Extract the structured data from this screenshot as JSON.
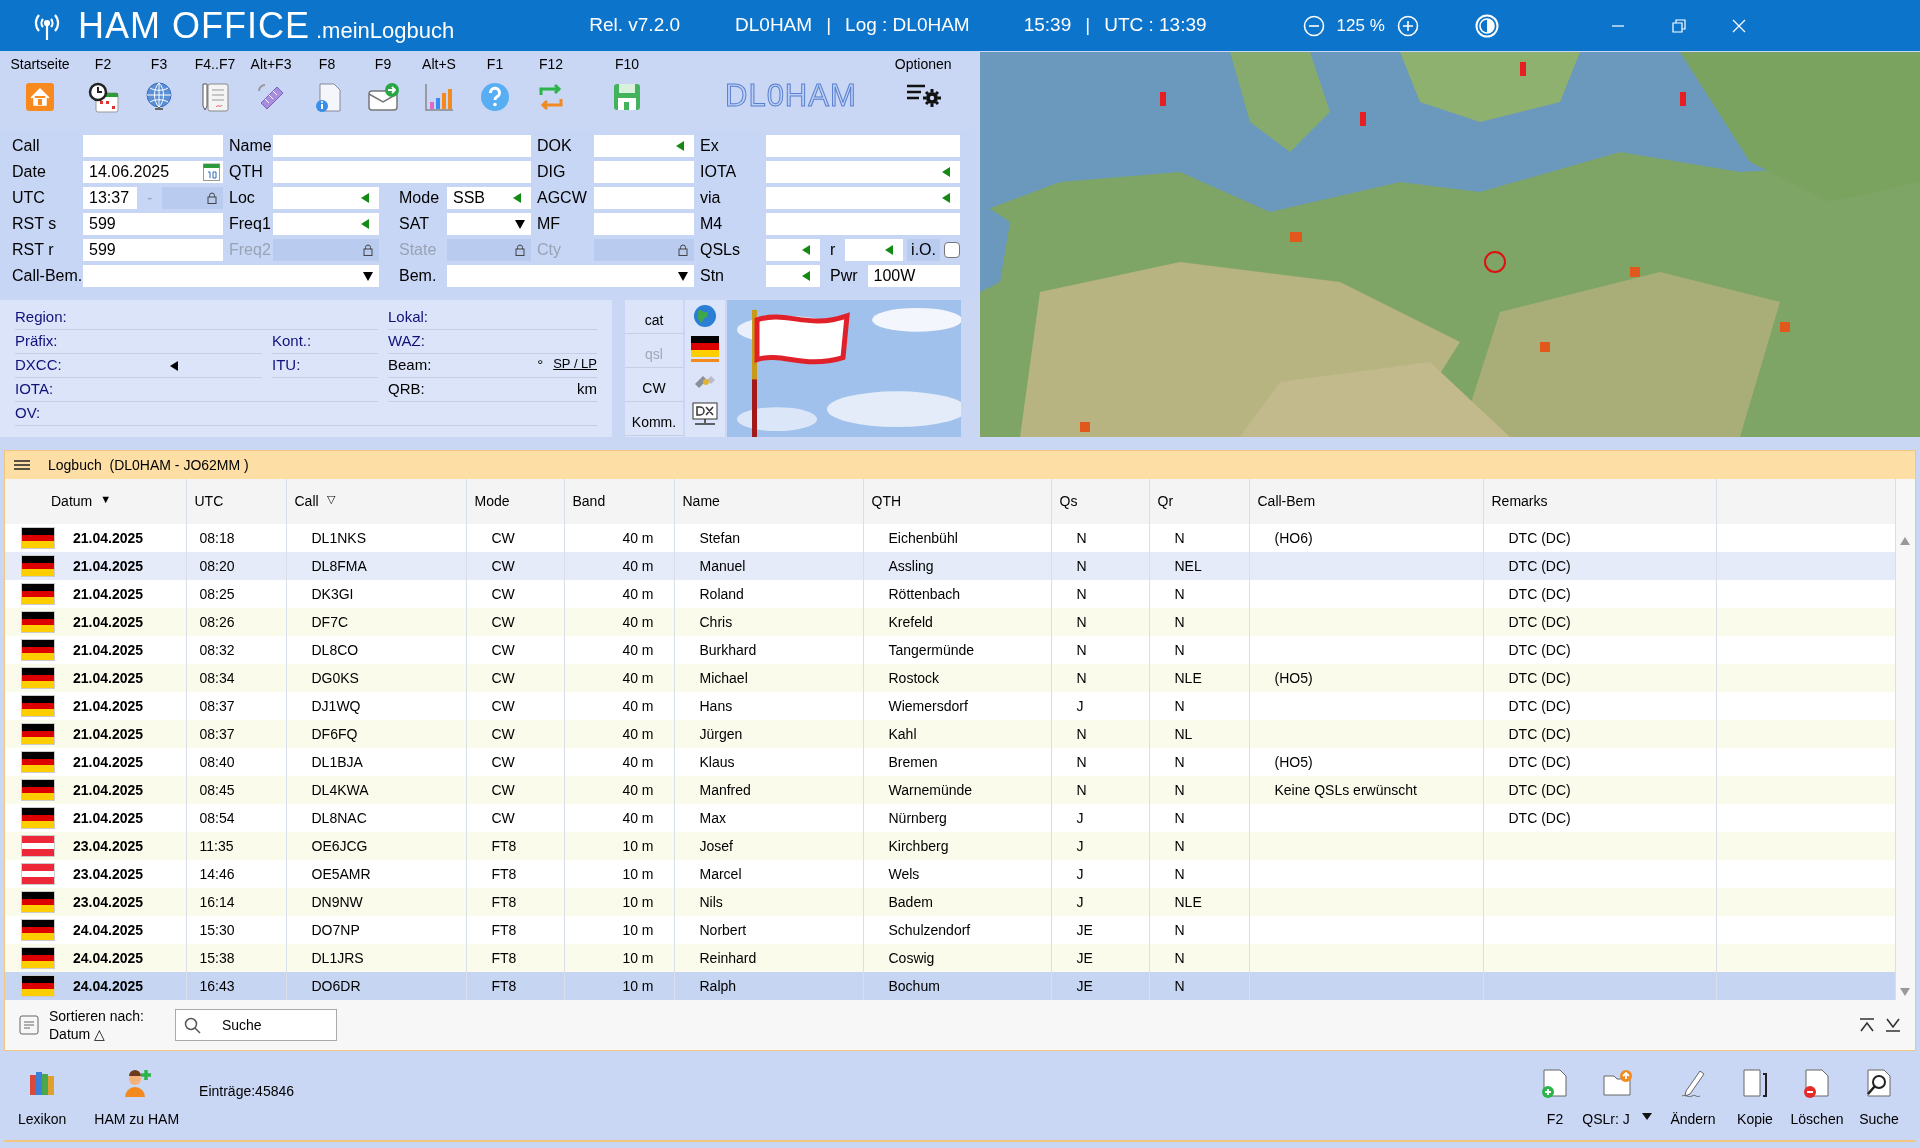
{
  "title_bar": {
    "app_name": "HAM OFFICE",
    "app_suffix": ".meinLogbuch",
    "release": "Rel. v7.2.0",
    "station": "DL0HAM",
    "separator_1": "|",
    "log": "Log : DL0HAM",
    "time": "15:39",
    "separator_2": "|",
    "utc": "UTC : 13:39",
    "zoom": "125 %"
  },
  "toolbar": {
    "items": [
      {
        "key": "Startseite"
      },
      {
        "key": "F2"
      },
      {
        "key": "F3"
      },
      {
        "key": "F4..F7"
      },
      {
        "key": "Alt+F3"
      },
      {
        "key": "F8"
      },
      {
        "key": "F9"
      },
      {
        "key": "Alt+S"
      },
      {
        "key": "F1"
      },
      {
        "key": "F12"
      },
      {
        "key": "F10"
      }
    ],
    "callsign": "DL0HAM",
    "options": "Optionen"
  },
  "form": {
    "rows": [
      {
        "fields": [
          {
            "label": "Call",
            "kind": "text"
          },
          {
            "label": "Name",
            "kind": "text"
          },
          {
            "label": "DOK",
            "kind": "text",
            "arrow": true
          },
          {
            "label": "Ex",
            "kind": "text"
          }
        ]
      },
      {
        "fields": [
          {
            "label": "Date",
            "kind": "date",
            "value": "14.06.2025"
          },
          {
            "label": "QTH",
            "kind": "text"
          },
          {
            "label": "DIG",
            "kind": "text"
          },
          {
            "label": "IOTA",
            "kind": "text",
            "arrow": true
          }
        ]
      },
      {
        "fields": [
          {
            "label": "UTC",
            "kind": "text",
            "value": "13:37",
            "extra": [
              {
                "label": "-",
                "kind": "text",
                "disabled": true,
                "locked": true
              }
            ]
          },
          {
            "label": "Loc",
            "kind": "text",
            "arrow": true
          },
          {
            "label": "Mode",
            "kind": "text",
            "value": "SSB",
            "arrow": true
          },
          {
            "label": "AGCW",
            "kind": "text"
          },
          {
            "label": "via",
            "kind": "text",
            "arrow": true
          }
        ]
      },
      {
        "fields": [
          {
            "label": "RST s",
            "kind": "text",
            "value": "599"
          },
          {
            "label": "Freq1",
            "kind": "text",
            "arrow": true
          },
          {
            "label": "SAT",
            "kind": "select"
          },
          {
            "label": "MF",
            "kind": "text"
          },
          {
            "label": "M4",
            "kind": "text"
          }
        ]
      },
      {
        "fields": [
          {
            "label": "RST r",
            "kind": "text",
            "value": "599"
          },
          {
            "label": "Freq2",
            "kind": "text",
            "disabled": true,
            "locked": true
          },
          {
            "label": "State",
            "kind": "text",
            "disabled": true,
            "locked": true
          },
          {
            "label": "Cty",
            "kind": "text",
            "disabled": true,
            "locked": true
          },
          {
            "label": "QSLs",
            "kind": "text",
            "arrow": true,
            "extra": [
              {
                "label": "r",
                "kind": "text",
                "arrow": true
              },
              {
                "label": "i.O.",
                "kind": "checkbox",
                "checked": false
              }
            ]
          }
        ]
      },
      {
        "fields": [
          {
            "label": "Call-Bem.",
            "kind": "select"
          },
          {
            "label": "Bem.",
            "kind": "select"
          },
          {
            "label": "Stn",
            "kind": "text",
            "arrow": true,
            "extra": [
              {
                "label": "Pwr",
                "kind": "text",
                "value": "100W"
              }
            ]
          }
        ]
      }
    ]
  },
  "info": {
    "region": "Region:",
    "lokal": "Lokal:",
    "praefix": "Präfix:",
    "kont": "Kont.:",
    "waz": "WAZ:",
    "dxcc": "DXCC:",
    "itu": "ITU:",
    "beam": "Beam:",
    "degree": "°",
    "sp_lp": "SP / LP",
    "iota": "IOTA:",
    "qrb": "QRB:",
    "km": "km",
    "ov": "OV:"
  },
  "side_buttons": [
    {
      "label": "cat",
      "disabled": false
    },
    {
      "label": "qsl",
      "disabled": true
    },
    {
      "label": "CW",
      "disabled": false
    },
    {
      "label": "Komm.",
      "disabled": false
    }
  ],
  "logbook": {
    "title": "Logbuch  (DL0HAM - JO62MM )",
    "columns": [
      {
        "label": "Datum",
        "sort": "▼"
      },
      {
        "label": "UTC"
      },
      {
        "label": "Call",
        "sort": "▽"
      },
      {
        "label": "Mode"
      },
      {
        "label": "Band"
      },
      {
        "label": "Name"
      },
      {
        "label": "QTH"
      },
      {
        "label": "Qs"
      },
      {
        "label": "Qr"
      },
      {
        "label": "Call-Bem"
      },
      {
        "label": "Remarks"
      }
    ],
    "rows": [
      {
        "kind": "de",
        "date": "21.04.2025",
        "utc": "08:18",
        "call": "DL1NKS",
        "mode": "CW",
        "band": "40 m",
        "name": "Stefan",
        "qth": "Eichenbühl",
        "qs": "N",
        "qr": "N",
        "call_bem": "(HO6)",
        "remarks": "DTC (DC)",
        "marked": false,
        "selected": false
      },
      {
        "kind": "de",
        "date": "21.04.2025",
        "utc": "08:20",
        "call": "DL8FMA",
        "mode": "CW",
        "band": "40 m",
        "name": "Manuel",
        "qth": "Assling",
        "qs": "N",
        "qr": "NEL",
        "remarks": "DTC (DC)",
        "marked": true,
        "selected": false
      },
      {
        "kind": "de",
        "date": "21.04.2025",
        "utc": "08:25",
        "call": "DK3GI",
        "mode": "CW",
        "band": "40 m",
        "name": "Roland",
        "qth": "Röttenbach",
        "qs": "N",
        "qr": "N",
        "remarks": "DTC (DC)",
        "marked": false,
        "selected": false
      },
      {
        "kind": "de",
        "date": "21.04.2025",
        "utc": "08:26",
        "call": "DF7C",
        "mode": "CW",
        "band": "40 m",
        "name": "Chris",
        "qth": "Krefeld",
        "qs": "N",
        "qr": "N",
        "remarks": "DTC (DC)",
        "marked": false,
        "selected": false
      },
      {
        "kind": "de",
        "date": "21.04.2025",
        "utc": "08:32",
        "call": "DL8CO",
        "mode": "CW",
        "band": "40 m",
        "name": "Burkhard",
        "qth": "Tangermünde",
        "qs": "N",
        "qr": "N",
        "remarks": "DTC (DC)",
        "marked": false,
        "selected": false
      },
      {
        "kind": "de",
        "date": "21.04.2025",
        "utc": "08:34",
        "call": "DG0KS",
        "mode": "CW",
        "band": "40 m",
        "name": "Michael",
        "qth": "Rostock",
        "qs": "N",
        "qr": "NLE",
        "call_bem": "(HO5)",
        "remarks": "DTC (DC)",
        "marked": false,
        "selected": false
      },
      {
        "kind": "de",
        "date": "21.04.2025",
        "utc": "08:37",
        "call": "DJ1WQ",
        "mode": "CW",
        "band": "40 m",
        "name": "Hans",
        "qth": "Wiemersdorf",
        "qs": "J",
        "qr": "N",
        "remarks": "DTC (DC)",
        "marked": false,
        "selected": false
      },
      {
        "kind": "de",
        "date": "21.04.2025",
        "utc": "08:37",
        "call": "DF6FQ",
        "mode": "CW",
        "band": "40 m",
        "name": "Jürgen",
        "qth": "Kahl",
        "qs": "N",
        "qr": "NL",
        "remarks": "DTC (DC)",
        "marked": false,
        "selected": false
      },
      {
        "kind": "de",
        "date": "21.04.2025",
        "utc": "08:40",
        "call": "DL1BJA",
        "mode": "CW",
        "band": "40 m",
        "name": "Klaus",
        "qth": "Bremen",
        "qs": "N",
        "qr": "N",
        "call_bem": "(HO5)",
        "remarks": "DTC (DC)",
        "marked": false,
        "selected": false
      },
      {
        "kind": "de",
        "date": "21.04.2025",
        "utc": "08:45",
        "call": "DL4KWA",
        "mode": "CW",
        "band": "40 m",
        "name": "Manfred",
        "qth": "Warnemünde",
        "qs": "N",
        "qr": "N",
        "call_bem": "Keine QSLs erwünscht",
        "remarks": "DTC (DC)",
        "marked": false,
        "selected": false
      },
      {
        "kind": "de",
        "date": "21.04.2025",
        "utc": "08:54",
        "call": "DL8NAC",
        "mode": "CW",
        "band": "40 m",
        "name": "Max",
        "qth": "Nürnberg",
        "qs": "J",
        "qr": "N",
        "remarks": "DTC (DC)",
        "marked": false,
        "selected": false
      },
      {
        "kind": "at",
        "date": "23.04.2025",
        "utc": "11:35",
        "call": "OE6JCG",
        "mode": "FT8",
        "band": "10 m",
        "name": "Josef",
        "qth": "Kirchberg",
        "qs": "J",
        "qr": "N",
        "marked": false,
        "selected": false
      },
      {
        "kind": "at",
        "date": "23.04.2025",
        "utc": "14:46",
        "call": "OE5AMR",
        "mode": "FT8",
        "band": "10 m",
        "name": "Marcel",
        "qth": "Wels",
        "qs": "J",
        "qr": "N",
        "marked": false,
        "selected": false
      },
      {
        "kind": "de",
        "date": "23.04.2025",
        "utc": "16:14",
        "call": "DN9NW",
        "mode": "FT8",
        "band": "10 m",
        "name": "Nils",
        "qth": "Badem",
        "qs": "J",
        "qr": "NLE",
        "marked": false,
        "selected": false
      },
      {
        "kind": "de",
        "date": "24.04.2025",
        "utc": "15:30",
        "call": "DO7NP",
        "mode": "FT8",
        "band": "10 m",
        "name": "Norbert",
        "qth": "Schulzendorf",
        "qs": "JE",
        "qr": "N",
        "marked": false,
        "selected": false
      },
      {
        "kind": "de",
        "date": "24.04.2025",
        "utc": "15:38",
        "call": "DL1JRS",
        "mode": "FT8",
        "band": "10 m",
        "name": "Reinhard",
        "qth": "Coswig",
        "qs": "JE",
        "qr": "N",
        "marked": false,
        "selected": false
      },
      {
        "kind": "de",
        "date": "24.04.2025",
        "utc": "16:43",
        "call": "DO6DR",
        "mode": "FT8",
        "band": "10 m",
        "name": "Ralph",
        "qth": "Bochum",
        "qs": "JE",
        "qr": "N",
        "marked": false,
        "selected": true
      }
    ]
  },
  "footer": {
    "sort_label": "Sortieren nach:",
    "sort_value": "Datum △",
    "search": {
      "placeholder": "Suche"
    }
  },
  "bottom_toolbar": {
    "left": [
      {
        "label": "Lexikon"
      },
      {
        "label": "HAM zu HAM"
      }
    ],
    "entries": "Einträge:45846",
    "right": [
      {
        "label": "F2",
        "kind": "button"
      },
      {
        "label": "QSLr: J",
        "kind": "menu"
      },
      {
        "label": "Ändern",
        "kind": "button"
      },
      {
        "label": "Kopie",
        "kind": "button"
      },
      {
        "label": "Löschen",
        "kind": "button"
      },
      {
        "label": "Suche",
        "kind": "button"
      }
    ]
  }
}
